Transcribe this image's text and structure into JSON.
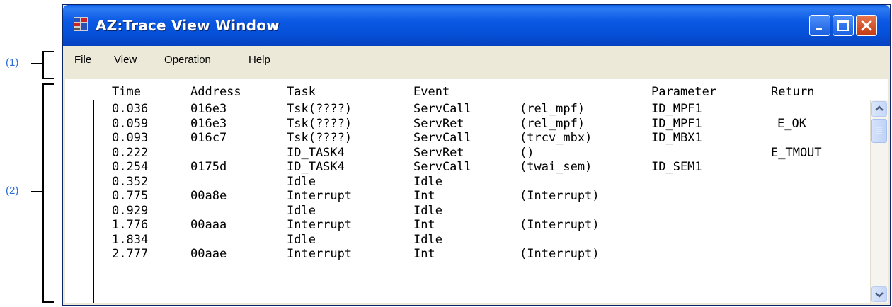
{
  "callouts": {
    "one": "(1)",
    "two": "(2)"
  },
  "window": {
    "title": "AZ:Trace View Window"
  },
  "menu": {
    "file": "File",
    "view": "View",
    "operation": "Operation",
    "help": "Help"
  },
  "columns": {
    "time": "Time",
    "address": "Address",
    "task": "Task",
    "event": "Event",
    "parameter": "Parameter",
    "return": "Return"
  },
  "rows": [
    {
      "time": "0.036",
      "address": "016e3",
      "task": "Tsk(????)",
      "event": "ServCall",
      "call": "(rel_mpf)",
      "parameter": "ID_MPF1",
      "ret": ""
    },
    {
      "time": "0.059",
      "address": "016e3",
      "task": "Tsk(????)",
      "event": "ServRet",
      "call": "(rel_mpf)",
      "parameter": "ID_MPF1",
      "ret": "E_OK"
    },
    {
      "time": "0.093",
      "address": "016c7",
      "task": "Tsk(????)",
      "event": "ServCall",
      "call": "(trcv_mbx)",
      "parameter": "ID_MBX1",
      "ret": ""
    },
    {
      "time": "0.222",
      "address": "",
      "task": "ID_TASK4",
      "event": "ServRet",
      "call": "()",
      "parameter": "",
      "ret": "E_TMOUT"
    },
    {
      "time": "0.254",
      "address": "0175d",
      "task": "ID_TASK4",
      "event": "ServCall",
      "call": "(twai_sem)",
      "parameter": "ID_SEM1",
      "ret": ""
    },
    {
      "time": "0.352",
      "address": "",
      "task": "Idle",
      "event": "Idle",
      "call": "",
      "parameter": "",
      "ret": ""
    },
    {
      "time": "0.775",
      "address": "00a8e",
      "task": "Interrupt",
      "event": "Int",
      "call": "(Interrupt)",
      "parameter": "",
      "ret": ""
    },
    {
      "time": "0.929",
      "address": "",
      "task": "Idle",
      "event": "Idle",
      "call": "",
      "parameter": "",
      "ret": ""
    },
    {
      "time": "1.776",
      "address": "00aaa",
      "task": "Interrupt",
      "event": "Int",
      "call": "(Interrupt)",
      "parameter": "",
      "ret": ""
    },
    {
      "time": "1.834",
      "address": "",
      "task": "Idle",
      "event": "Idle",
      "call": "",
      "parameter": "",
      "ret": ""
    },
    {
      "time": "2.777",
      "address": "00aae",
      "task": "Interrupt",
      "event": "Int",
      "call": "(Interrupt)",
      "parameter": "",
      "ret": ""
    }
  ],
  "icons": {
    "app": "trace-app-icon",
    "minimize": "minimize-icon",
    "maximize": "maximize-icon",
    "close": "close-icon",
    "up": "scroll-up-icon",
    "down": "scroll-down-icon"
  },
  "colors": {
    "titlebar": "#0a58e3",
    "callout": "#2f6fd6",
    "close_button": "#c33a12"
  }
}
